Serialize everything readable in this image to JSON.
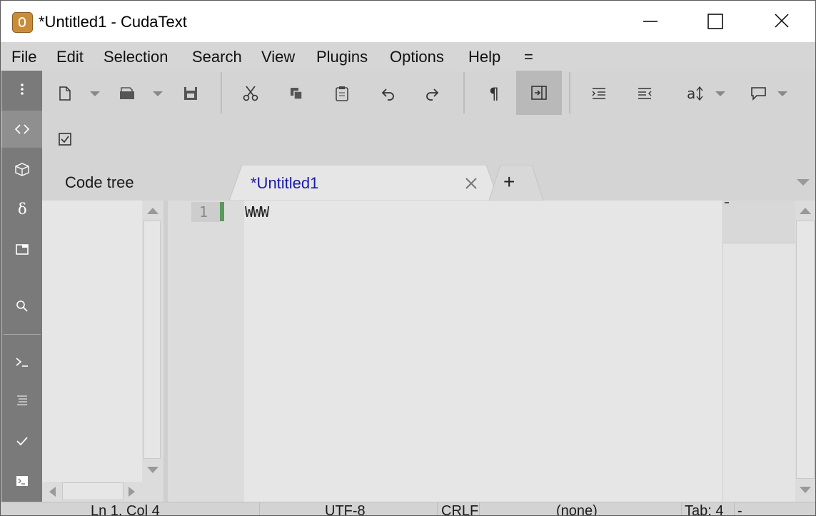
{
  "window": {
    "title": "*Untitled1 - CudaText"
  },
  "menu": [
    "File",
    "Edit",
    "Selection",
    "Search",
    "View",
    "Plugins",
    "Options",
    "Help",
    "="
  ],
  "sidepanel": {
    "title": "Code tree"
  },
  "tabs": {
    "active_label": "*Untitled1",
    "add_label": "+"
  },
  "editor": {
    "lines": [
      {
        "number": "1",
        "text": "WWW"
      }
    ]
  },
  "statusbar": {
    "position": "Ln 1, Col 4",
    "encoding": "UTF-8",
    "line_endings": "CRLF",
    "lexer": "(none)",
    "tab": "Tab: 4",
    "extra": "-"
  },
  "icons": {
    "sidebar": [
      "menu-dots-icon",
      "code-tree-icon",
      "project-icon",
      "delta-icon",
      "tabs-icon",
      "search-icon",
      "console-icon",
      "output-icon",
      "validate-icon",
      "terminal-icon"
    ],
    "toolbar": [
      "new-file-icon",
      "open-file-icon",
      "save-icon",
      "cut-icon",
      "copy-icon",
      "paste-icon",
      "undo-icon",
      "redo-icon",
      "pilcrow-icon",
      "minimap-toggle-icon",
      "indent-icon",
      "unindent-icon",
      "case-icon",
      "comment-icon",
      "checkbox-icon"
    ]
  },
  "colors": {
    "tab_text": "#1a1aa8",
    "gutter_modified": "#5a9a5a"
  }
}
